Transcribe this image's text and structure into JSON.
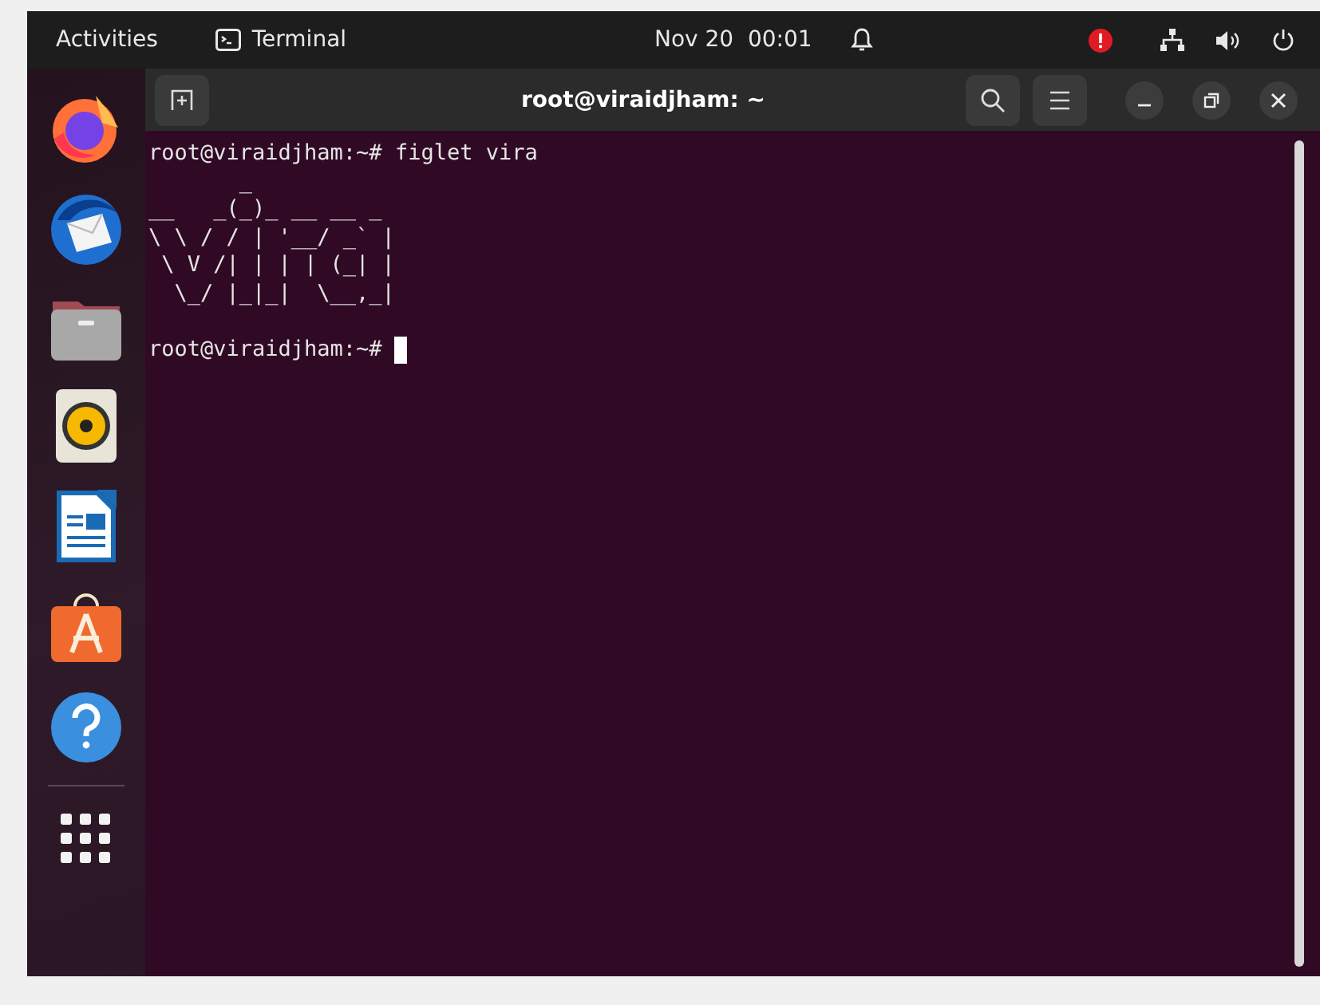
{
  "top_bar": {
    "activities": "Activities",
    "app_name": "Terminal",
    "clock": "Nov 20  00:01"
  },
  "window": {
    "title": "root@viraidjham: ~"
  },
  "terminal": {
    "lines": [
      {
        "kind": "prompt",
        "prompt": "root@viraidjham:~#",
        "command": "figlet vira"
      },
      {
        "kind": "output",
        "text": "       _           "
      },
      {
        "kind": "output",
        "text": "__   _(_)_ __ __ _ "
      },
      {
        "kind": "output",
        "text": "\\ \\ / / | '__/ _` |"
      },
      {
        "kind": "output",
        "text": " \\ V /| | | | (_| |"
      },
      {
        "kind": "output",
        "text": "  \\_/ |_|_|  \\__,_|"
      },
      {
        "kind": "blank"
      },
      {
        "kind": "prompt",
        "prompt": "root@viraidjham:~#",
        "cursor": true
      }
    ]
  }
}
